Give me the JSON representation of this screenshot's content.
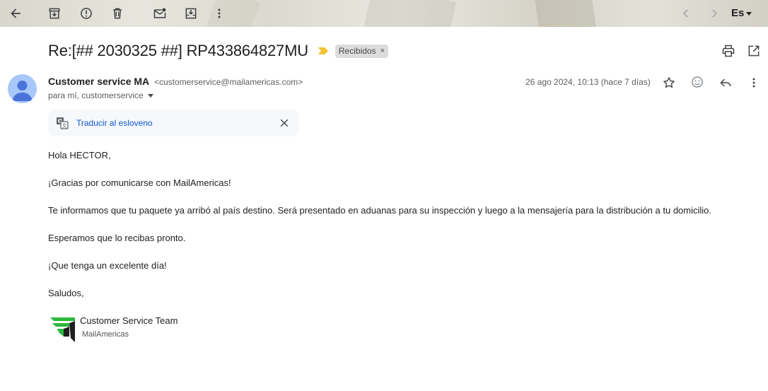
{
  "toolbar": {
    "back": "back-arrow-icon",
    "archive": "archive-icon",
    "spam": "report-spam-icon",
    "delete": "trash-icon",
    "mark_unread": "mark-unread-icon",
    "move": "move-to-icon",
    "more": "more-vert-icon",
    "prev": "chevron-left-icon",
    "next": "chevron-right-icon",
    "language": "Es"
  },
  "message": {
    "subject": "Re:[## 2030325 ##] RP433864827MU",
    "label": "Recibidos",
    "label_close": "×",
    "sender_name": "Customer service MA",
    "sender_email": "<customerservice@mailamericas.com>",
    "to_line": "para mí, customerservice",
    "date": "26 ago 2024, 10:13 (hace 7 días)"
  },
  "translate": {
    "link": "Traducir al esloveno"
  },
  "body": [
    "Hola HECTOR,",
    "¡Gracias por comunicarse con MailAmericas!",
    "Te informamos que tu paquete ya arribó al país destino. Será presentado en aduanas para su inspección y luego a la mensajería para la distribución a tu domicilio.",
    "Esperamos que lo recibas pronto.",
    "¡Que tenga un excelente día!",
    "Saludos,"
  ],
  "signature": {
    "name": "Customer Service Team",
    "company": "MailAmericas"
  },
  "colors": {
    "link": "#0b57d0",
    "importance": "#f2c230",
    "logo_green": "#2db83d",
    "logo_dark": "#1f1f1f",
    "avatar": "#a8c7fa"
  }
}
